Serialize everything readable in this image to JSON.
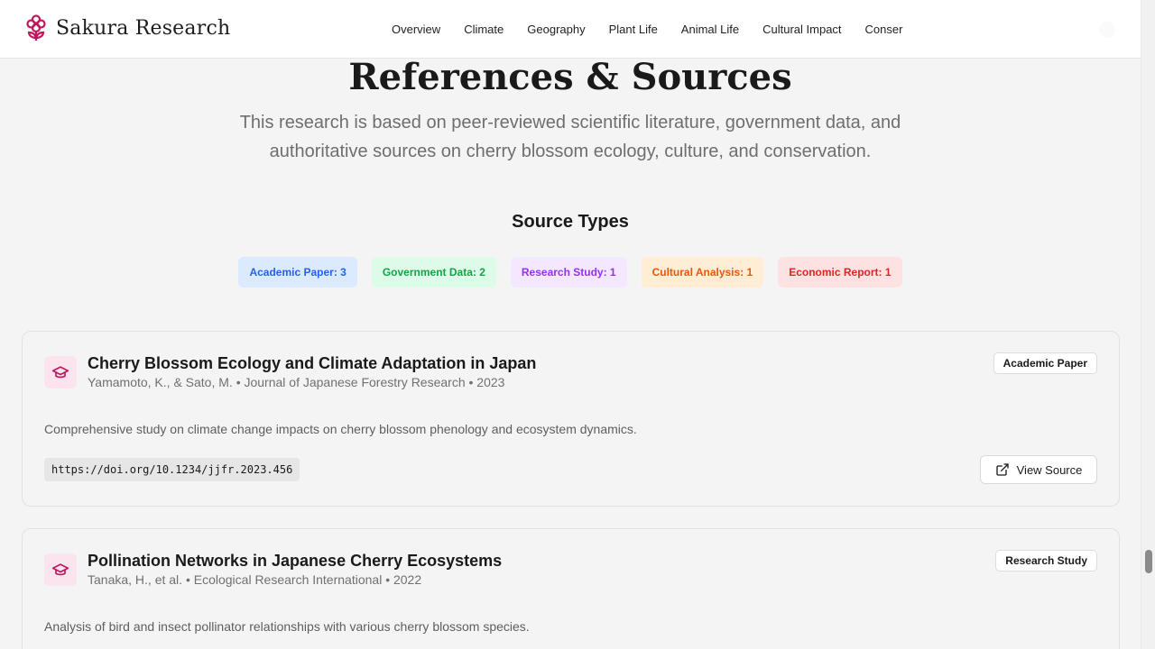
{
  "brand": {
    "name": "Sakura Research",
    "icon": "sakura-flower-icon",
    "accent": "#be185d"
  },
  "nav": [
    "Overview",
    "Climate",
    "Geography",
    "Plant Life",
    "Animal Life",
    "Cultural Impact",
    "Conser"
  ],
  "page": {
    "title": "References & Sources",
    "intro": "This research is based on peer-reviewed scientific literature, government data, and authoritative sources on cherry blossom ecology, culture, and conservation."
  },
  "source_types": {
    "title": "Source Types",
    "chips": [
      {
        "label": "Academic Paper: 3",
        "color": "#2563eb"
      },
      {
        "label": "Government Data: 2",
        "color": "#16a34a"
      },
      {
        "label": "Research Study: 1",
        "color": "#9333ea"
      },
      {
        "label": "Cultural Analysis: 1",
        "color": "#ea580c"
      },
      {
        "label": "Economic Report: 1",
        "color": "#dc2626"
      }
    ]
  },
  "references": [
    {
      "title": "Cherry Blossom Ecology and Climate Adaptation in Japan",
      "meta": "Yamamoto, K., & Sato, M. • Journal of Japanese Forestry Research • 2023",
      "type": "Academic Paper",
      "description": "Comprehensive study on climate change impacts on cherry blossom phenology and ecosystem dynamics.",
      "url": "https://doi.org/10.1234/jjfr.2023.456",
      "button": "View Source",
      "icon": "graduation-cap-icon"
    },
    {
      "title": "Pollination Networks in Japanese Cherry Ecosystems",
      "meta": "Tanaka, H., et al. • Ecological Research International • 2022",
      "type": "Research Study",
      "description": "Analysis of bird and insect pollinator relationships with various cherry blossom species.",
      "icon": "graduation-cap-icon"
    }
  ]
}
